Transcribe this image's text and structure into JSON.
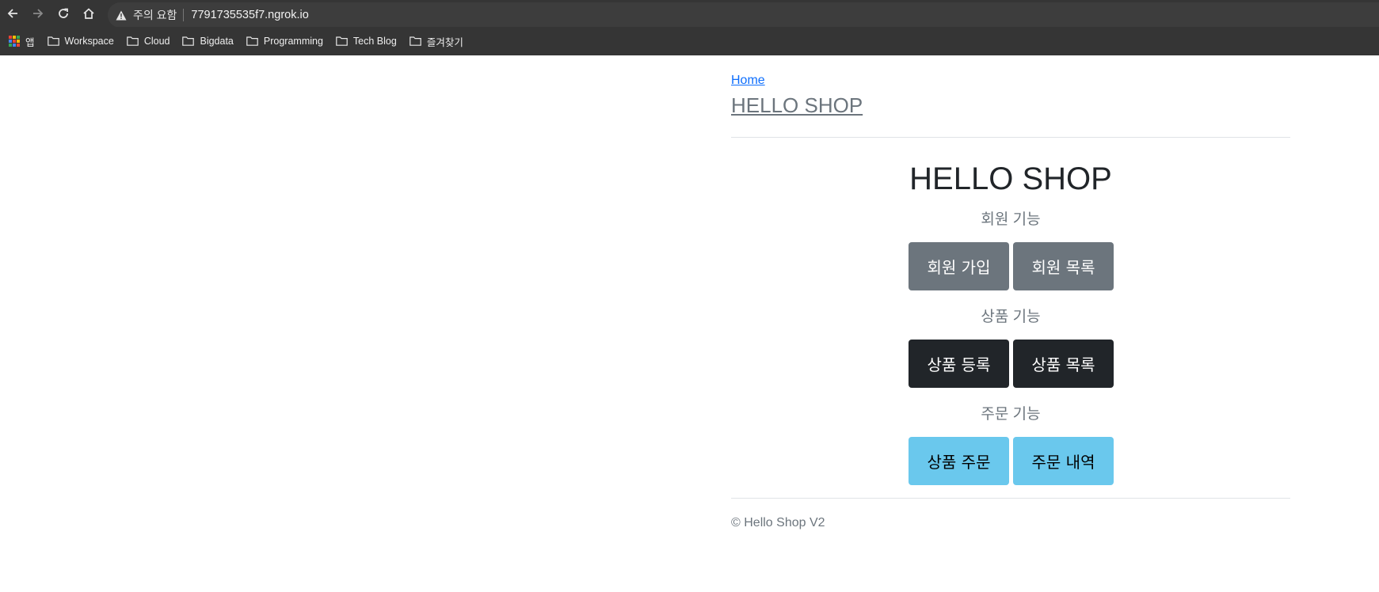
{
  "browser": {
    "security_label": "주의 요함",
    "url": "7791735535f7.ngrok.io",
    "bookmarks": {
      "apps_label": "앱",
      "folders": [
        "Workspace",
        "Cloud",
        "Bigdata",
        "Programming",
        "Tech Blog",
        "즐겨찾기"
      ]
    }
  },
  "header": {
    "home_link": "Home",
    "brand": "HELLO SHOP"
  },
  "main": {
    "title": "HELLO SHOP",
    "member_section": {
      "label": "회원 기능",
      "join_button": "회원 가입",
      "list_button": "회원 목록"
    },
    "item_section": {
      "label": "상품 기능",
      "register_button": "상품 등록",
      "list_button": "상품 목록"
    },
    "order_section": {
      "label": "주문 기능",
      "order_button": "상품 주문",
      "history_button": "주문 내역"
    }
  },
  "footer": {
    "text": "© Hello Shop V2"
  },
  "colors": {
    "secondary": "#6c757d",
    "dark": "#212529",
    "info": "#6ac8ed",
    "link": "#0d6efd"
  }
}
